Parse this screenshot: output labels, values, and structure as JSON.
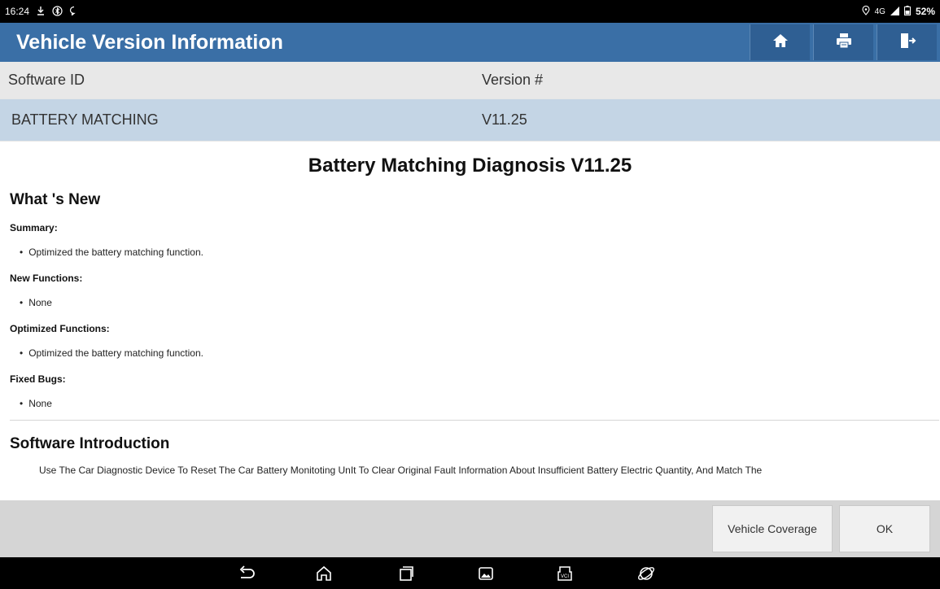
{
  "statusbar": {
    "time": "16:24",
    "network": "4G",
    "battery": "52%",
    "icons": [
      "download-icon",
      "bluetooth-icon",
      "chat-icon",
      "location-icon",
      "signal-icon",
      "battery-icon"
    ]
  },
  "titlebar": {
    "title": "Vehicle Version Information",
    "actions": [
      "home-icon",
      "print-icon",
      "exit-icon"
    ]
  },
  "table": {
    "headers": [
      "Software ID",
      "Version #"
    ],
    "rows": [
      [
        "BATTERY MATCHING",
        "V11.25"
      ]
    ]
  },
  "content": {
    "doc_title": "Battery Matching Diagnosis V11.25",
    "whats_new_heading": "What 's New",
    "sections": [
      {
        "label": "Summary:",
        "items": [
          "Optimized the battery matching function."
        ]
      },
      {
        "label": "New Functions:",
        "items": [
          "None"
        ]
      },
      {
        "label": "Optimized Functions:",
        "items": [
          "Optimized the battery matching function."
        ]
      },
      {
        "label": "Fixed Bugs:",
        "items": [
          "None"
        ]
      }
    ],
    "intro_heading": "Software Introduction",
    "intro_text": "Use The Car Diagnostic Device To Reset The Car Battery Monitoting UnIt To Clear Original Fault Information About Insufficient Battery Electric Quantity, And Match The"
  },
  "buttons": {
    "coverage": "Vehicle Coverage",
    "ok": "OK"
  },
  "navbar": {
    "icons": [
      "back-icon",
      "home-icon",
      "recents-icon",
      "screenshot-icon",
      "vci-icon",
      "browser-icon"
    ]
  },
  "colors": {
    "titlebar": "#3a6fa6",
    "selected_row": "#c4d5e5",
    "header_row": "#e8e8e8",
    "bottom_bar": "#d5d5d5"
  }
}
